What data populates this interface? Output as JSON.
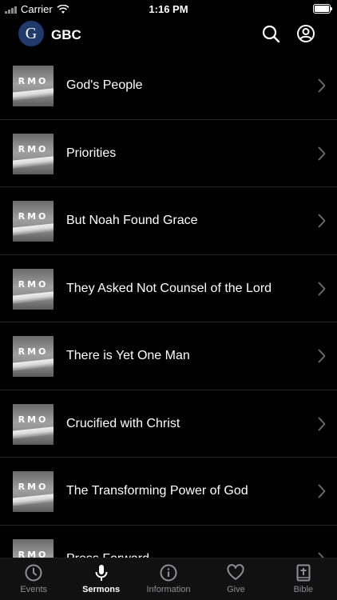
{
  "status_bar": {
    "carrier": "Carrier",
    "time": "1:16 PM"
  },
  "header": {
    "avatar_letter": "G",
    "title": "GBC"
  },
  "thumbnail_mark": "RMO",
  "sermons": [
    {
      "title": "God's People"
    },
    {
      "title": "Priorities"
    },
    {
      "title": "But Noah Found Grace"
    },
    {
      "title": "They Asked Not Counsel of the Lord"
    },
    {
      "title": "There is Yet One Man"
    },
    {
      "title": "Crucified with Christ"
    },
    {
      "title": "The Transforming Power of God"
    },
    {
      "title": "Press Forward"
    }
  ],
  "tabs": [
    {
      "label": "Events",
      "icon": "clock-icon"
    },
    {
      "label": "Sermons",
      "icon": "microphone-icon"
    },
    {
      "label": "Information",
      "icon": "info-icon"
    },
    {
      "label": "Give",
      "icon": "heart-icon"
    },
    {
      "label": "Bible",
      "icon": "bible-icon"
    }
  ],
  "active_tab": "Sermons",
  "colors": {
    "background": "#000000",
    "tab_inactive": "#8e8e93",
    "avatar": "#1f3a6b"
  }
}
